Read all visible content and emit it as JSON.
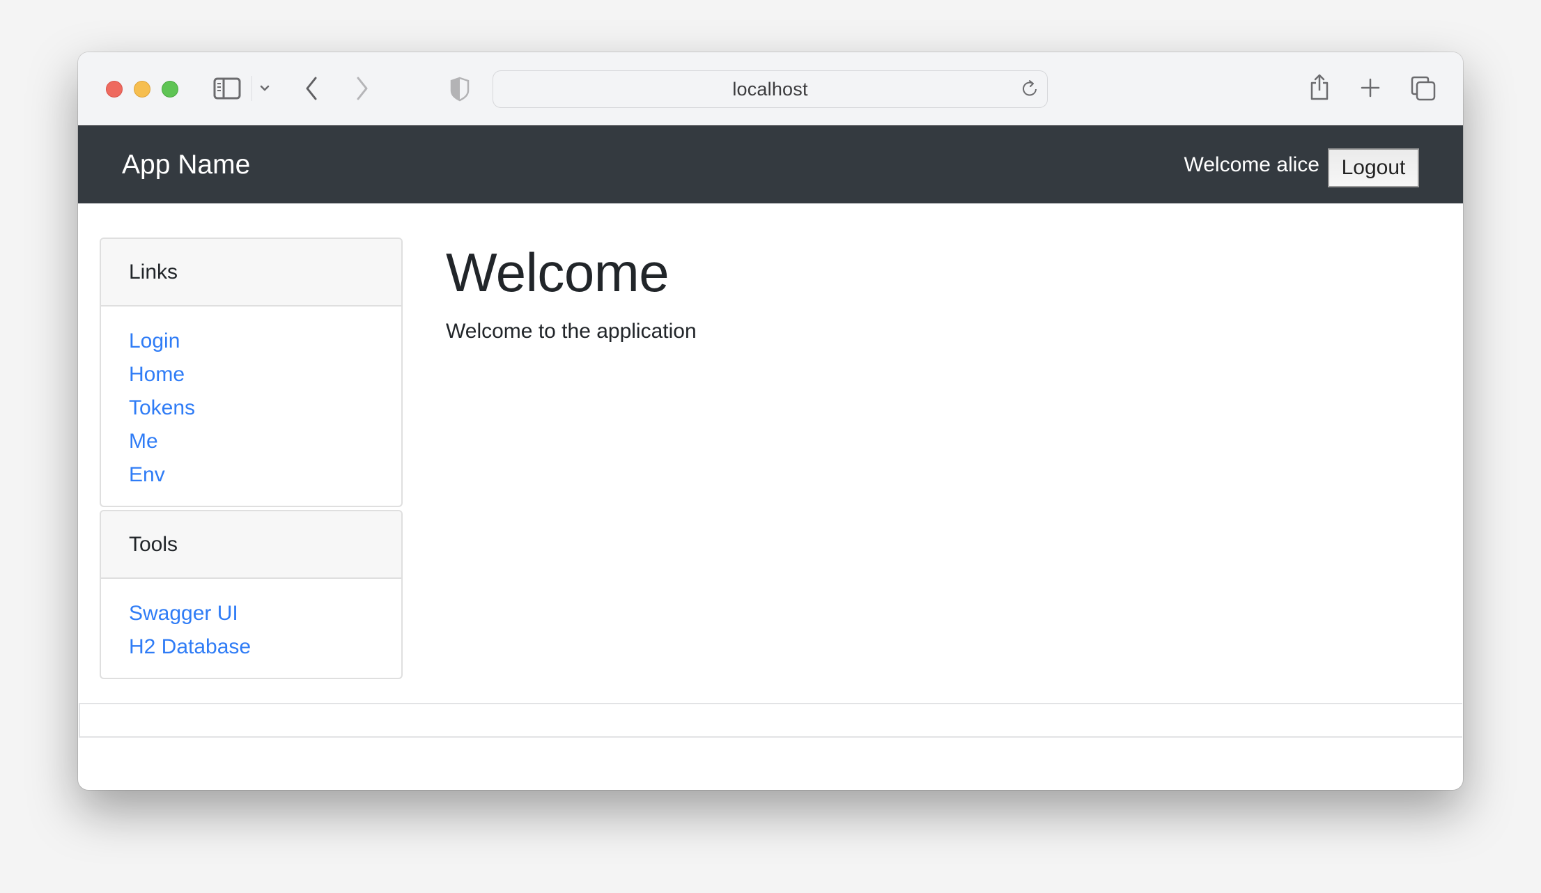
{
  "browser": {
    "url": "localhost",
    "icons": {
      "sidebar": "sidebar-toggle-icon",
      "tab_group_menu": "chevron-down-icon",
      "back": "chevron-left-icon",
      "forward": "chevron-right-icon",
      "privacy": "shield-icon",
      "reload": "reload-icon",
      "share": "share-icon",
      "new_tab": "plus-icon",
      "tab_overview": "tabs-overview-icon"
    }
  },
  "navbar": {
    "brand": "App Name",
    "welcome_text": "Welcome alice",
    "logout_label": "Logout"
  },
  "sidebar": {
    "cards": [
      {
        "title": "Links",
        "links": [
          "Login",
          "Home",
          "Tokens",
          "Me",
          "Env"
        ]
      },
      {
        "title": "Tools",
        "links": [
          "Swagger UI",
          "H2 Database"
        ]
      }
    ]
  },
  "main": {
    "title": "Welcome",
    "text": "Welcome to the application"
  },
  "colors": {
    "navbar_bg": "#343a40",
    "link": "#2f7cf6",
    "text": "#212529"
  }
}
